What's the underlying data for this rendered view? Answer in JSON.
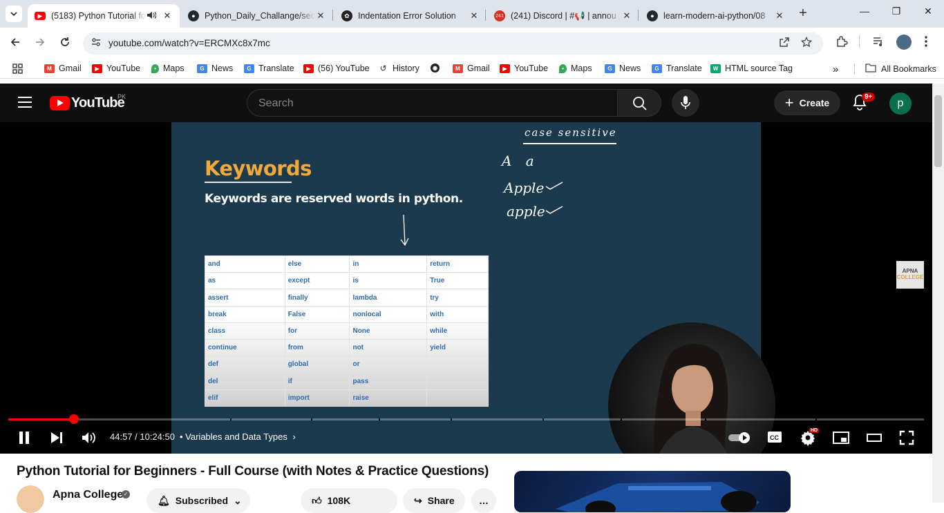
{
  "browser": {
    "tabs": [
      {
        "title": "(5183) Python Tutorial fo",
        "active": true,
        "audio": true,
        "favicon": "youtube-icon"
      },
      {
        "title": "Python_Daily_Challange/sec",
        "active": false,
        "favicon": "github-icon"
      },
      {
        "title": "Indentation Error Solution",
        "active": false,
        "favicon": "openai-icon"
      },
      {
        "title": "(241) Discord | #📢 | annou",
        "active": false,
        "favicon": "discord-icon",
        "badge": "241"
      },
      {
        "title": "learn-modern-ai-python/08",
        "active": false,
        "favicon": "github-icon"
      }
    ],
    "url": "youtube.com/watch?v=ERCMXc8x7mc",
    "bookmarks": [
      {
        "label": "Gmail",
        "icon": "gmail-icon"
      },
      {
        "label": "YouTube",
        "icon": "youtube-icon"
      },
      {
        "label": "Maps",
        "icon": "maps-icon"
      },
      {
        "label": "News",
        "icon": "news-icon"
      },
      {
        "label": "Translate",
        "icon": "translate-icon"
      },
      {
        "label": "(56) YouTube",
        "icon": "youtube-icon"
      },
      {
        "label": "History",
        "icon": "history-icon"
      },
      {
        "label": "",
        "icon": "globe-icon"
      },
      {
        "label": "Gmail",
        "icon": "gmail-icon"
      },
      {
        "label": "YouTube",
        "icon": "youtube-icon"
      },
      {
        "label": "Maps",
        "icon": "maps-icon"
      },
      {
        "label": "News",
        "icon": "news-icon"
      },
      {
        "label": "Translate",
        "icon": "translate-icon"
      },
      {
        "label": "HTML source Tag",
        "icon": "w3schools-icon"
      }
    ],
    "all_bookmarks": "All Bookmarks",
    "overflow": "»"
  },
  "youtube": {
    "logo_text": "YouTube",
    "country": "PK",
    "search_placeholder": "Search",
    "create_label": "Create",
    "notification_count": "9+",
    "user_initial": "p"
  },
  "slide": {
    "title": "Keywords",
    "subtitle": "Keywords are reserved words in python.",
    "table": [
      [
        "and",
        "else",
        "in",
        "return"
      ],
      [
        "as",
        "except",
        "is",
        "True"
      ],
      [
        "assert",
        "finally",
        "lambda",
        "try"
      ],
      [
        "break",
        "False",
        "nonlocal",
        "with"
      ],
      [
        "class",
        "for",
        "None",
        "while"
      ],
      [
        "continue",
        "from",
        "not",
        "yield"
      ],
      [
        "def",
        "global",
        "or",
        ""
      ],
      [
        "del",
        "if",
        "pass",
        ""
      ],
      [
        "elif",
        "import",
        "raise",
        ""
      ]
    ],
    "annotations": {
      "case": "case sensitive",
      "letters": "A a",
      "apple_upper": "Apple",
      "apple_lower": "apple"
    },
    "watermark_line1": "APNA",
    "watermark_line2": "COLLEGE"
  },
  "player": {
    "current_time": "44:57",
    "duration": "10:24:50",
    "time_display": "44:57 / 10:24:50",
    "chapter": "• Variables and Data Types",
    "progress_fraction": 0.0719,
    "hd_badge": "HD"
  },
  "video": {
    "title": "Python Tutorial for Beginners - Full Course (with Notes & Practice Questions)",
    "channel": "Apna College",
    "subscribe_label": "Subscribed",
    "likes": "108K",
    "share_label": "Share"
  },
  "colors": {
    "youtube_red": "#ff0000",
    "slide_bg": "#1c3a4d",
    "keyword_title": "#f2a93a",
    "table_text": "#2b6db0"
  }
}
